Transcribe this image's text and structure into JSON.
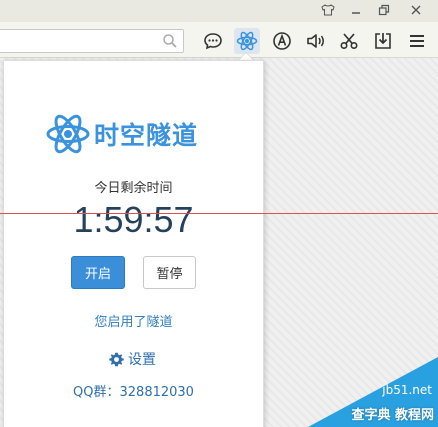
{
  "browser": {
    "address_value": "",
    "toolbar_icons": [
      "chat-icon",
      "atom-icon",
      "font-icon",
      "speaker-icon",
      "scissors-icon",
      "download-icon",
      "menu-icon"
    ],
    "window_controls": [
      "shirt-icon",
      "minimize-icon",
      "restore-icon",
      "close-icon"
    ]
  },
  "popup": {
    "logo_text": "时空隧道",
    "remaining_label": "今日剩余时间",
    "timer": "1:59:57",
    "start_button": "开启",
    "pause_button": "暂停",
    "status": "您启用了隧道",
    "settings_label": "设置",
    "qq_label": "QQ群：",
    "qq_number": "328812030"
  },
  "watermark": {
    "url": "jb51.net",
    "text": "查字典 教程网"
  },
  "colors": {
    "brand_blue": "#3a93dc",
    "timer_text": "#25425d",
    "start_button_bg": "#3a8fd8",
    "overlay_line": "#e05050"
  }
}
